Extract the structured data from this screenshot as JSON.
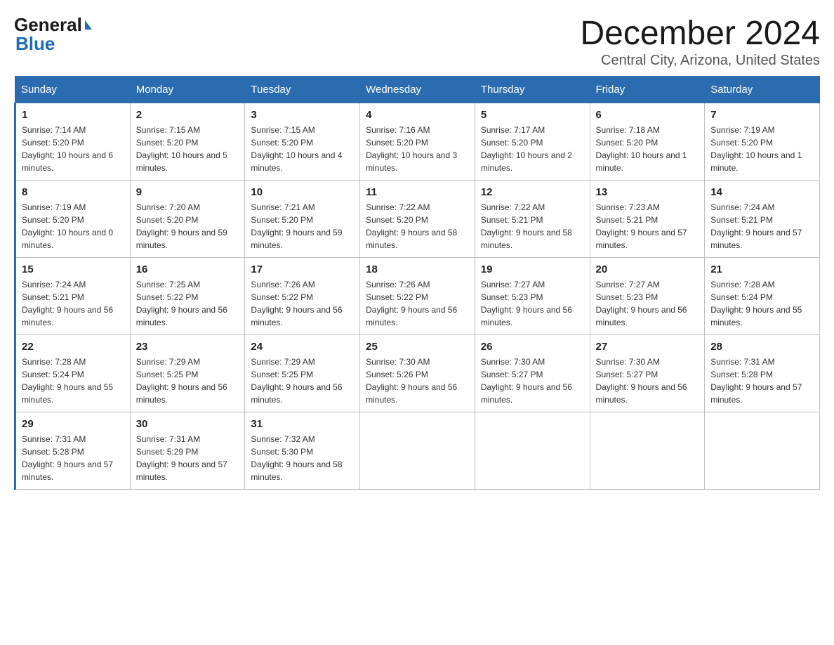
{
  "header": {
    "logo_general": "General",
    "logo_blue": "Blue",
    "month_title": "December 2024",
    "location": "Central City, Arizona, United States"
  },
  "days_of_week": [
    "Sunday",
    "Monday",
    "Tuesday",
    "Wednesday",
    "Thursday",
    "Friday",
    "Saturday"
  ],
  "weeks": [
    [
      {
        "day": "1",
        "sunrise": "7:14 AM",
        "sunset": "5:20 PM",
        "daylight": "10 hours and 6 minutes."
      },
      {
        "day": "2",
        "sunrise": "7:15 AM",
        "sunset": "5:20 PM",
        "daylight": "10 hours and 5 minutes."
      },
      {
        "day": "3",
        "sunrise": "7:15 AM",
        "sunset": "5:20 PM",
        "daylight": "10 hours and 4 minutes."
      },
      {
        "day": "4",
        "sunrise": "7:16 AM",
        "sunset": "5:20 PM",
        "daylight": "10 hours and 3 minutes."
      },
      {
        "day": "5",
        "sunrise": "7:17 AM",
        "sunset": "5:20 PM",
        "daylight": "10 hours and 2 minutes."
      },
      {
        "day": "6",
        "sunrise": "7:18 AM",
        "sunset": "5:20 PM",
        "daylight": "10 hours and 1 minute."
      },
      {
        "day": "7",
        "sunrise": "7:19 AM",
        "sunset": "5:20 PM",
        "daylight": "10 hours and 1 minute."
      }
    ],
    [
      {
        "day": "8",
        "sunrise": "7:19 AM",
        "sunset": "5:20 PM",
        "daylight": "10 hours and 0 minutes."
      },
      {
        "day": "9",
        "sunrise": "7:20 AM",
        "sunset": "5:20 PM",
        "daylight": "9 hours and 59 minutes."
      },
      {
        "day": "10",
        "sunrise": "7:21 AM",
        "sunset": "5:20 PM",
        "daylight": "9 hours and 59 minutes."
      },
      {
        "day": "11",
        "sunrise": "7:22 AM",
        "sunset": "5:20 PM",
        "daylight": "9 hours and 58 minutes."
      },
      {
        "day": "12",
        "sunrise": "7:22 AM",
        "sunset": "5:21 PM",
        "daylight": "9 hours and 58 minutes."
      },
      {
        "day": "13",
        "sunrise": "7:23 AM",
        "sunset": "5:21 PM",
        "daylight": "9 hours and 57 minutes."
      },
      {
        "day": "14",
        "sunrise": "7:24 AM",
        "sunset": "5:21 PM",
        "daylight": "9 hours and 57 minutes."
      }
    ],
    [
      {
        "day": "15",
        "sunrise": "7:24 AM",
        "sunset": "5:21 PM",
        "daylight": "9 hours and 56 minutes."
      },
      {
        "day": "16",
        "sunrise": "7:25 AM",
        "sunset": "5:22 PM",
        "daylight": "9 hours and 56 minutes."
      },
      {
        "day": "17",
        "sunrise": "7:26 AM",
        "sunset": "5:22 PM",
        "daylight": "9 hours and 56 minutes."
      },
      {
        "day": "18",
        "sunrise": "7:26 AM",
        "sunset": "5:22 PM",
        "daylight": "9 hours and 56 minutes."
      },
      {
        "day": "19",
        "sunrise": "7:27 AM",
        "sunset": "5:23 PM",
        "daylight": "9 hours and 56 minutes."
      },
      {
        "day": "20",
        "sunrise": "7:27 AM",
        "sunset": "5:23 PM",
        "daylight": "9 hours and 56 minutes."
      },
      {
        "day": "21",
        "sunrise": "7:28 AM",
        "sunset": "5:24 PM",
        "daylight": "9 hours and 55 minutes."
      }
    ],
    [
      {
        "day": "22",
        "sunrise": "7:28 AM",
        "sunset": "5:24 PM",
        "daylight": "9 hours and 55 minutes."
      },
      {
        "day": "23",
        "sunrise": "7:29 AM",
        "sunset": "5:25 PM",
        "daylight": "9 hours and 56 minutes."
      },
      {
        "day": "24",
        "sunrise": "7:29 AM",
        "sunset": "5:25 PM",
        "daylight": "9 hours and 56 minutes."
      },
      {
        "day": "25",
        "sunrise": "7:30 AM",
        "sunset": "5:26 PM",
        "daylight": "9 hours and 56 minutes."
      },
      {
        "day": "26",
        "sunrise": "7:30 AM",
        "sunset": "5:27 PM",
        "daylight": "9 hours and 56 minutes."
      },
      {
        "day": "27",
        "sunrise": "7:30 AM",
        "sunset": "5:27 PM",
        "daylight": "9 hours and 56 minutes."
      },
      {
        "day": "28",
        "sunrise": "7:31 AM",
        "sunset": "5:28 PM",
        "daylight": "9 hours and 57 minutes."
      }
    ],
    [
      {
        "day": "29",
        "sunrise": "7:31 AM",
        "sunset": "5:28 PM",
        "daylight": "9 hours and 57 minutes."
      },
      {
        "day": "30",
        "sunrise": "7:31 AM",
        "sunset": "5:29 PM",
        "daylight": "9 hours and 57 minutes."
      },
      {
        "day": "31",
        "sunrise": "7:32 AM",
        "sunset": "5:30 PM",
        "daylight": "9 hours and 58 minutes."
      },
      null,
      null,
      null,
      null
    ]
  ],
  "labels": {
    "sunrise": "Sunrise:",
    "sunset": "Sunset:",
    "daylight": "Daylight:"
  }
}
